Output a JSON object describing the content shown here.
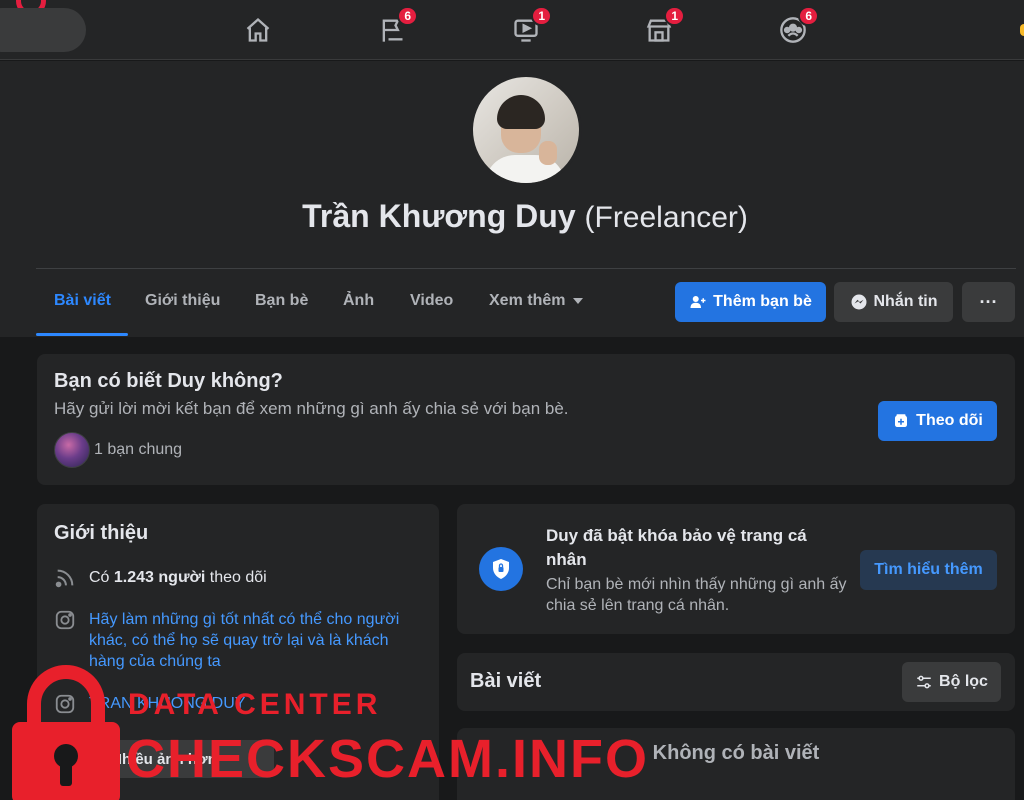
{
  "topnav": {
    "badges": {
      "pages": "6",
      "watch": "1",
      "marketplace": "1",
      "groups": "6"
    }
  },
  "profile": {
    "name": "Trần Khương Duy",
    "alt_name": "(Freelancer)"
  },
  "tabs": [
    {
      "label": "Bài viết",
      "active": true
    },
    {
      "label": "Giới thiệu"
    },
    {
      "label": "Bạn bè"
    },
    {
      "label": "Ảnh"
    },
    {
      "label": "Video"
    },
    {
      "label": "Xem thêm"
    }
  ],
  "actions": {
    "add_friend": "Thêm bạn bè",
    "message": "Nhắn tin",
    "more": "···"
  },
  "know_card": {
    "title": "Bạn có biết Duy không?",
    "subtitle": "Hãy gửi lời mời kết bạn để xem những gì anh ấy chia sẻ với bạn bè.",
    "mutual": "1 bạn chung",
    "follow_button": "Theo dõi"
  },
  "intro": {
    "title": "Giới thiệu",
    "followers_prefix": "Có ",
    "followers_count": "1.243 người",
    "followers_suffix": " theo dõi",
    "bio_line1": "Hãy làm những gì tốt nhất có thể cho người",
    "bio_line2": "khác, có thể họ sẽ quay trở lại và là khách",
    "bio_line3": "hàng của chúng ta",
    "instagram": "TRAN KHUONG DUY",
    "photos_button": "Nhiều ảnh hơn"
  },
  "lock_card": {
    "title_line1": "Duy đã bật khóa bảo vệ trang cá",
    "title_line2": "nhân",
    "desc_line1": "Chỉ bạn bè mới nhìn thấy những gì anh ấy",
    "desc_line2": "chia sẻ lên trang cá nhân.",
    "learn_more": "Tìm hiểu thêm"
  },
  "posts": {
    "title": "Bài viết",
    "filter_button": "Bộ lọc",
    "empty": "Không có bài viết"
  },
  "watermark": {
    "top": "DATA CENTER",
    "main": "CHECKSCAM.INFO"
  },
  "colors": {
    "background": "#18191a",
    "surface": "#242526",
    "accent": "#2374e1",
    "badge": "#e41e3f",
    "watermark": "#e8202b"
  }
}
